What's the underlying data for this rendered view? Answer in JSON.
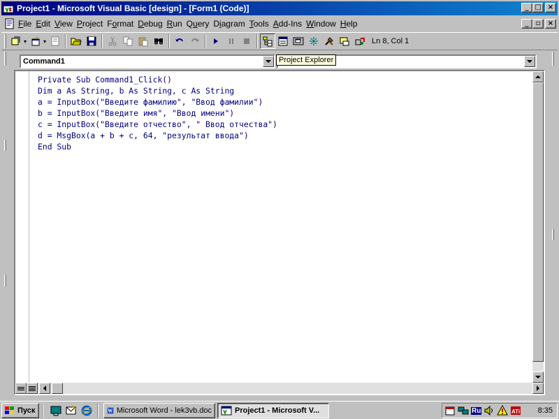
{
  "window": {
    "title": "Project1 - Microsoft Visual Basic [design] - [Form1 (Code)]",
    "minimize_glyph": "_",
    "maximize_glyph": "□",
    "close_glyph": "×",
    "mdi_restore_glyph": "▫"
  },
  "menu": {
    "items": [
      {
        "u": "F",
        "rest": "ile"
      },
      {
        "u": "E",
        "rest": "dit"
      },
      {
        "u": "V",
        "rest": "iew"
      },
      {
        "u": "P",
        "rest": "roject"
      },
      {
        "pre": "F",
        "u": "o",
        "rest": "rmat"
      },
      {
        "u": "D",
        "rest": "ebug"
      },
      {
        "u": "R",
        "rest": "un"
      },
      {
        "pre": "Q",
        "u": "u",
        "rest": "ery"
      },
      {
        "pre": "D",
        "u": "i",
        "rest": "agram"
      },
      {
        "u": "T",
        "rest": "ools"
      },
      {
        "u": "A",
        "rest": "dd-Ins"
      },
      {
        "u": "W",
        "rest": "indow"
      },
      {
        "u": "H",
        "rest": "elp"
      }
    ]
  },
  "toolbar": {
    "cursor_position": "Ln 8, Col 1"
  },
  "code_window": {
    "object_combo": "Command1",
    "procedure_combo": "",
    "tooltip": "Project Explorer",
    "lines": [
      "Private Sub Command1_Click()",
      "Dim a As String, b As String, c As String",
      "a = InputBox(\"Введите фамилию\", \"Ввод фамилии\")",
      "b = InputBox(\"Введите имя\", \"Ввод имени\")",
      "c = InputBox(\"Введите отчество\", \" Ввод отчества\")",
      "d = MsgBox(a + b + c, 64, \"результат ввода\")",
      "End Sub"
    ]
  },
  "taskbar": {
    "start_label": "Пуск",
    "tasks": [
      {
        "label": "Microsoft Word - lek3vb.doc",
        "active": false
      },
      {
        "label": "Project1 - Microsoft V...",
        "active": true
      }
    ],
    "language": "Ru",
    "clock": "8:35"
  },
  "colors": {
    "titlebar_start": "#000080",
    "titlebar_end": "#1084d0",
    "code_text": "#000080",
    "tooltip_bg": "#ffffe1"
  }
}
